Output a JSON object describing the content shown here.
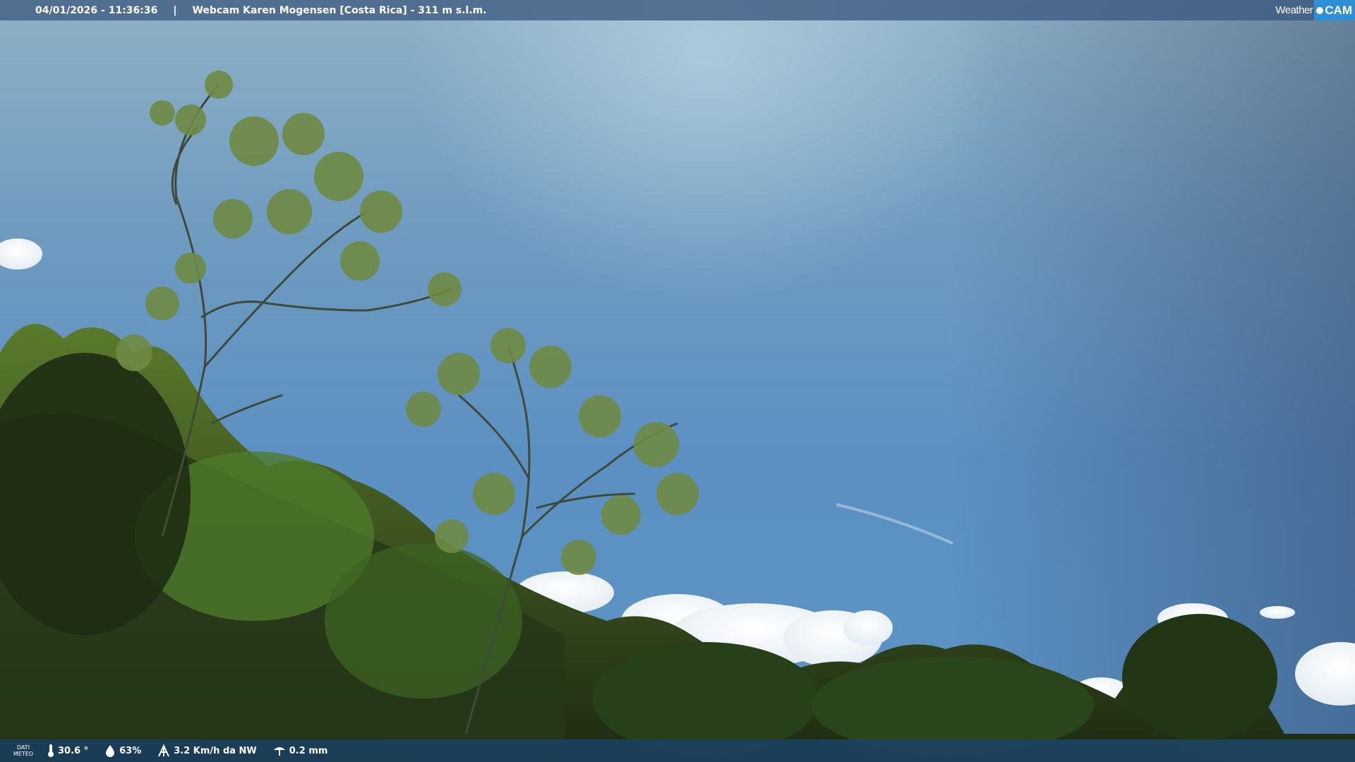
{
  "header": {
    "timestamp": "04/01/2026 - 11:36:36",
    "separator": "|",
    "camera_title": "Webcam Karen Mogensen [Costa Rica] - 311 m s.l.m."
  },
  "logo": {
    "weather_text": "Weather",
    "cam_text": "CAM"
  },
  "footer": {
    "dati_line1": "DATI",
    "dati_line2": "METEO",
    "temperature": "30.6 °",
    "humidity": "63%",
    "wind": "3.2 Km/h da NW",
    "rain": "0.2 mm"
  },
  "colors": {
    "accent": "#2e8fd6",
    "sky": "#5c90c2",
    "foliage": "#2f4a1e"
  },
  "icons": {
    "temperature": "thermometer-icon",
    "humidity": "drop-icon",
    "wind": "wind-icon",
    "rain": "rain-gauge-icon"
  }
}
